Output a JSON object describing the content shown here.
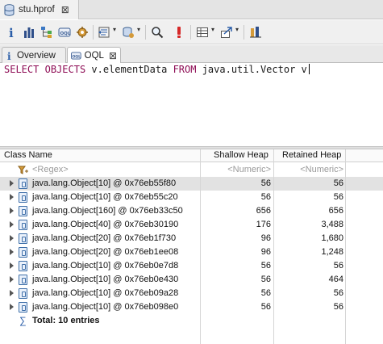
{
  "editor_tab": {
    "label": "stu.hprof"
  },
  "subtabs": [
    {
      "label": "Overview",
      "active": false
    },
    {
      "label": "OQL",
      "active": true
    }
  ],
  "toolbar": {
    "icons": [
      "info-icon",
      "histogram-icon",
      "dominator-tree-icon",
      "oql-icon",
      "gear-icon",
      "overview-icon",
      "heap-dump-icon",
      "search-icon",
      "exclamation-icon",
      "table-icon",
      "export-icon",
      "compare-icon"
    ]
  },
  "query": {
    "keyword1": "SELECT",
    "keyword2": "OBJECTS",
    "part1": "v.elementData",
    "keyword3": "FROM",
    "part2": "java.util.Vector v"
  },
  "table": {
    "columns": [
      "Class Name",
      "Shallow Heap",
      "Retained Heap"
    ],
    "filters": {
      "class": "<Regex>",
      "shallow": "<Numeric>",
      "retained": "<Numeric>"
    },
    "rows": [
      {
        "name": "java.lang.Object[10] @ 0x76eb55f80",
        "shallow": "56",
        "retained": "56"
      },
      {
        "name": "java.lang.Object[10] @ 0x76eb55c20",
        "shallow": "56",
        "retained": "56"
      },
      {
        "name": "java.lang.Object[160] @ 0x76eb33c50",
        "shallow": "656",
        "retained": "656"
      },
      {
        "name": "java.lang.Object[40] @ 0x76eb30190",
        "shallow": "176",
        "retained": "3,488"
      },
      {
        "name": "java.lang.Object[20] @ 0x76eb1f730",
        "shallow": "96",
        "retained": "1,680"
      },
      {
        "name": "java.lang.Object[20] @ 0x76eb1ee08",
        "shallow": "96",
        "retained": "1,248"
      },
      {
        "name": "java.lang.Object[10] @ 0x76eb0e7d8",
        "shallow": "56",
        "retained": "56"
      },
      {
        "name": "java.lang.Object[10] @ 0x76eb0e430",
        "shallow": "56",
        "retained": "464"
      },
      {
        "name": "java.lang.Object[10] @ 0x76eb09a28",
        "shallow": "56",
        "retained": "56"
      },
      {
        "name": "java.lang.Object[10] @ 0x76eb098e0",
        "shallow": "56",
        "retained": "56"
      }
    ],
    "total": "Total: 10 entries",
    "total_symbol": "∑"
  }
}
